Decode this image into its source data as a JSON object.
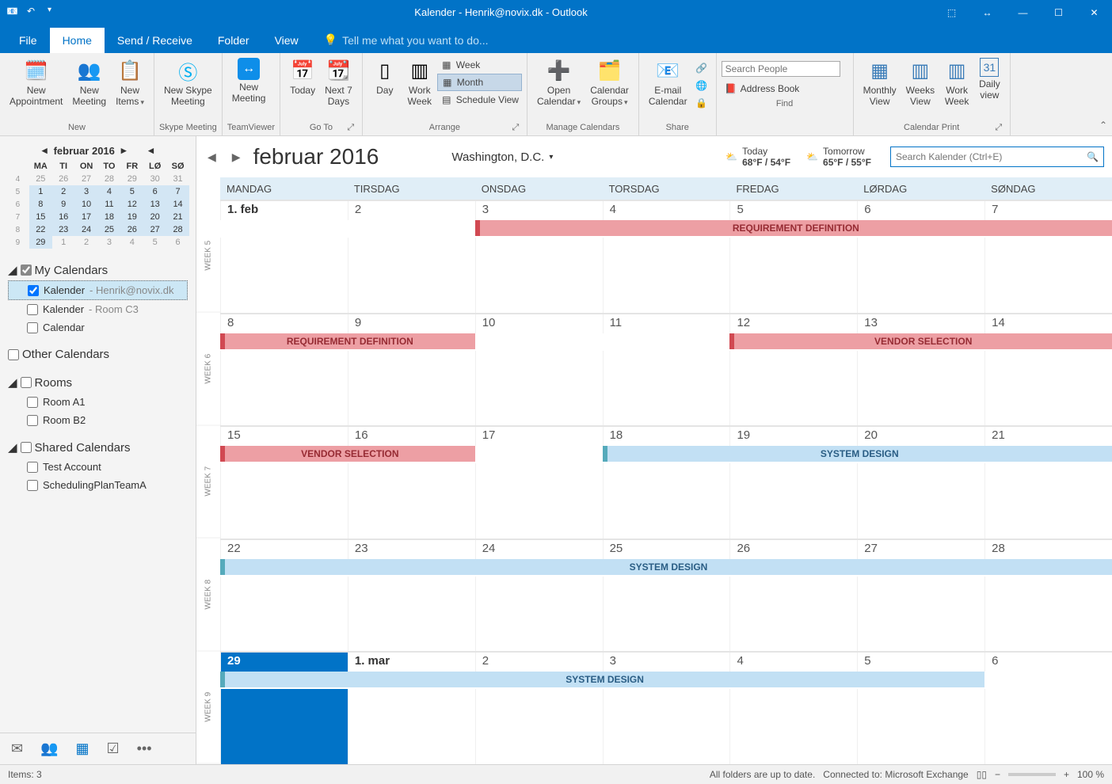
{
  "window_title": "Kalender - Henrik@novix.dk - Outlook",
  "tabs": {
    "file": "File",
    "home": "Home",
    "send_receive": "Send / Receive",
    "folder": "Folder",
    "view": "View"
  },
  "tell_me": "Tell me what you want to do...",
  "ribbon": {
    "new": {
      "label": "New",
      "appointment": "New\nAppointment",
      "meeting": "New\nMeeting",
      "items": "New\nItems"
    },
    "skype": {
      "label": "Skype Meeting",
      "btn": "New Skype\nMeeting"
    },
    "teamviewer": {
      "label": "TeamViewer",
      "btn": "New\nMeeting"
    },
    "goto": {
      "label": "Go To",
      "today": "Today",
      "next7": "Next 7\nDays"
    },
    "arrange": {
      "label": "Arrange",
      "day": "Day",
      "work_week": "Work\nWeek",
      "week": "Week",
      "month": "Month",
      "schedule": "Schedule View"
    },
    "manage": {
      "label": "Manage Calendars",
      "open": "Open\nCalendar",
      "groups": "Calendar\nGroups"
    },
    "share": {
      "label": "Share",
      "email": "E-mail\nCalendar"
    },
    "find": {
      "label": "Find",
      "search_placeholder": "Search People",
      "addressbook": "Address Book"
    },
    "print": {
      "label": "Calendar Print",
      "monthly": "Monthly\nView",
      "weeks": "Weeks\nView",
      "workweek": "Work\nWeek",
      "daily": "Daily\nview"
    }
  },
  "mini_cal": {
    "title": "februar 2016",
    "dow": [
      "MA",
      "TI",
      "ON",
      "TO",
      "FR",
      "LØ",
      "SØ"
    ],
    "weeks": [
      {
        "wk": "4",
        "days": [
          "25",
          "26",
          "27",
          "28",
          "29",
          "30",
          "31"
        ],
        "gray": true
      },
      {
        "wk": "5",
        "days": [
          "1",
          "2",
          "3",
          "4",
          "5",
          "6",
          "7"
        ]
      },
      {
        "wk": "6",
        "days": [
          "8",
          "9",
          "10",
          "11",
          "12",
          "13",
          "14"
        ]
      },
      {
        "wk": "7",
        "days": [
          "15",
          "16",
          "17",
          "18",
          "19",
          "20",
          "21"
        ]
      },
      {
        "wk": "8",
        "days": [
          "22",
          "23",
          "24",
          "25",
          "26",
          "27",
          "28"
        ]
      },
      {
        "wk": "9",
        "days": [
          "29",
          "1",
          "2",
          "3",
          "4",
          "5",
          "6"
        ],
        "tailgray": 6
      }
    ]
  },
  "tree": {
    "my": {
      "label": "My Calendars",
      "items": [
        {
          "label": "Kalender",
          "suffix": " - Henrik@novix.dk",
          "checked": true,
          "selected": true
        },
        {
          "label": "Kalender",
          "suffix": " - Room C3"
        },
        {
          "label": "Calendar"
        }
      ]
    },
    "other": {
      "label": "Other Calendars"
    },
    "rooms": {
      "label": "Rooms",
      "items": [
        {
          "label": "Room A1"
        },
        {
          "label": "Room B2"
        }
      ]
    },
    "shared": {
      "label": "Shared Calendars",
      "items": [
        {
          "label": "Test Account"
        },
        {
          "label": "SchedulingPlanTeamA"
        }
      ]
    }
  },
  "main": {
    "title": "februar 2016",
    "location": "Washington,  D.C.",
    "weather": {
      "today": {
        "label": "Today",
        "temp": "68°F / 54°F"
      },
      "tomorrow": {
        "label": "Tomorrow",
        "temp": "65°F / 55°F"
      }
    },
    "search_placeholder": "Search Kalender (Ctrl+E)",
    "day_headers": [
      "MANDAG",
      "TIRSDAG",
      "ONSDAG",
      "TORSDAG",
      "FREDAG",
      "LØRDAG",
      "SØNDAG"
    ],
    "weeks": [
      {
        "label": "WEEK 5",
        "dates": [
          "1. feb",
          "2",
          "3",
          "4",
          "5",
          "6",
          "7"
        ],
        "firstday": 0,
        "events": [
          {
            "text": "REQUIREMENT DEFINITION",
            "color": "red",
            "start": 2,
            "span": 5
          }
        ]
      },
      {
        "label": "WEEK 6",
        "dates": [
          "8",
          "9",
          "10",
          "11",
          "12",
          "13",
          "14"
        ],
        "events": [
          {
            "text": "REQUIREMENT DEFINITION",
            "color": "red",
            "start": 0,
            "span": 2
          },
          {
            "text": "VENDOR SELECTION",
            "color": "red",
            "start": 4,
            "span": 3
          }
        ]
      },
      {
        "label": "WEEK 7",
        "dates": [
          "15",
          "16",
          "17",
          "18",
          "19",
          "20",
          "21"
        ],
        "events": [
          {
            "text": "VENDOR SELECTION",
            "color": "red",
            "start": 0,
            "span": 2
          },
          {
            "text": "SYSTEM DESIGN",
            "color": "blue",
            "start": 3,
            "span": 4
          }
        ]
      },
      {
        "label": "WEEK 8",
        "dates": [
          "22",
          "23",
          "24",
          "25",
          "26",
          "27",
          "28"
        ],
        "events": [
          {
            "text": "SYSTEM DESIGN",
            "color": "blue",
            "start": 0,
            "span": 7
          }
        ]
      },
      {
        "label": "WEEK 9",
        "dates": [
          "29",
          "1. mar",
          "2",
          "3",
          "4",
          "5",
          "6"
        ],
        "firstday": 1,
        "today": 0,
        "events": [
          {
            "text": "SYSTEM DESIGN",
            "color": "blue",
            "start": 0,
            "span": 6
          }
        ]
      }
    ]
  },
  "status": {
    "items": "Items: 3",
    "folders": "All folders are up to date.",
    "connected": "Connected to: Microsoft Exchange",
    "zoom": "100 %"
  }
}
